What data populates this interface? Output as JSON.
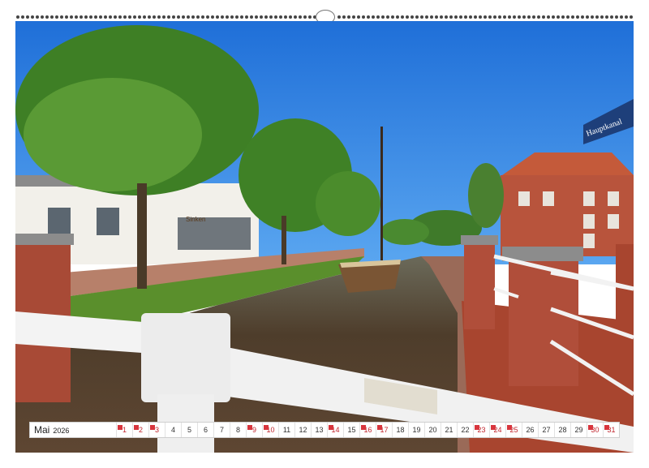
{
  "calendar": {
    "month": "Mai",
    "year": "2026",
    "days": [
      {
        "n": "1",
        "sun": true
      },
      {
        "n": "2",
        "sun": true
      },
      {
        "n": "3",
        "sun": true
      },
      {
        "n": "4",
        "sun": false
      },
      {
        "n": "5",
        "sun": false
      },
      {
        "n": "6",
        "sun": false
      },
      {
        "n": "7",
        "sun": false
      },
      {
        "n": "8",
        "sun": false
      },
      {
        "n": "9",
        "sun": true
      },
      {
        "n": "10",
        "sun": true
      },
      {
        "n": "11",
        "sun": false
      },
      {
        "n": "12",
        "sun": false
      },
      {
        "n": "13",
        "sun": false
      },
      {
        "n": "14",
        "sun": true
      },
      {
        "n": "15",
        "sun": false
      },
      {
        "n": "16",
        "sun": true
      },
      {
        "n": "17",
        "sun": true
      },
      {
        "n": "18",
        "sun": false
      },
      {
        "n": "19",
        "sun": false
      },
      {
        "n": "20",
        "sun": false
      },
      {
        "n": "21",
        "sun": false
      },
      {
        "n": "22",
        "sun": false
      },
      {
        "n": "23",
        "sun": true
      },
      {
        "n": "24",
        "sun": true
      },
      {
        "n": "25",
        "sun": true
      },
      {
        "n": "26",
        "sun": false
      },
      {
        "n": "27",
        "sun": false
      },
      {
        "n": "28",
        "sun": false
      },
      {
        "n": "29",
        "sun": false
      },
      {
        "n": "30",
        "sun": true
      },
      {
        "n": "31",
        "sun": true
      }
    ]
  },
  "photo": {
    "shop_sign": "Sinken",
    "street_sign": "Hauptkanal"
  },
  "colors": {
    "sky": "#2a7fe6",
    "water": "#5b4631",
    "grass": "#5a8f2c",
    "brick": "#b04e3a",
    "sunday_marker": "#d8353d"
  }
}
